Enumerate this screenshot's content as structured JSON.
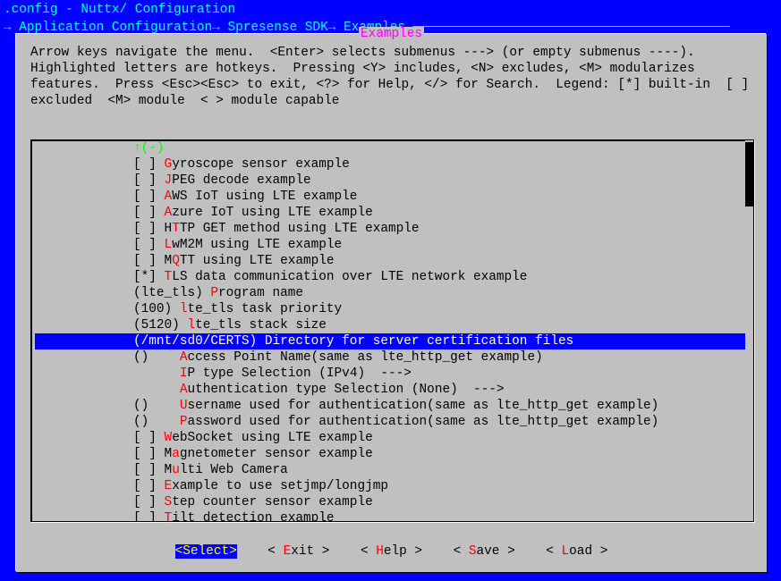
{
  "title_line": ".config - Nuttx/ Configuration",
  "breadcrumb": "→ Application Configuration→ Spresense SDK→ Examples ─────────────────────────────────────────",
  "dialog_title": "Examples",
  "help_text": "Arrow keys navigate the menu.  <Enter> selects submenus ---> (or empty submenus ----).  Highlighted letters are hotkeys.  Pressing <Y> includes, <N> excludes, <M> modularizes features.  Press <Esc><Esc> to exit, <?> for Help, </> for Search.  Legend: [*] built-in  [ ] excluded  <M> module  < > module capable",
  "scroll_indicator": "↑(-)",
  "menu": [
    {
      "prefix": "[ ] ",
      "hot": "G",
      "rest": "yroscope sensor example"
    },
    {
      "prefix": "[ ] ",
      "hot": "J",
      "rest": "PEG decode example"
    },
    {
      "prefix": "[ ] ",
      "hot": "A",
      "rest": "WS IoT using LTE example"
    },
    {
      "prefix": "[ ] ",
      "hot": "A",
      "rest": "zure IoT using LTE example"
    },
    {
      "prefix": "[ ] H",
      "hot": "T",
      "rest": "TP GET method using LTE example"
    },
    {
      "prefix": "[ ] ",
      "hot": "L",
      "rest": "wM2M using LTE example"
    },
    {
      "prefix": "[ ] M",
      "hot": "Q",
      "rest": "TT using LTE example"
    },
    {
      "prefix": "[*] ",
      "hot": "T",
      "rest": "LS data communication over LTE network example"
    },
    {
      "prefix": "(lte_tls) ",
      "hot": "P",
      "rest": "rogram name"
    },
    {
      "prefix": "(100) ",
      "hot": "l",
      "rest": "te_tls task priority"
    },
    {
      "prefix": "(5120) ",
      "hot": "l",
      "rest": "te_tls stack size"
    },
    {
      "prefix": "(/mnt/sd0/CERTS) ",
      "hot": "D",
      "rest": "irectory for server certification files",
      "selected": true
    },
    {
      "prefix": "()    ",
      "hot": "A",
      "rest": "ccess Point Name(same as lte_http_get example)"
    },
    {
      "prefix": "      ",
      "hot": "I",
      "rest": "P type Selection (IPv4)  --->"
    },
    {
      "prefix": "      ",
      "hot": "A",
      "rest": "uthentication type Selection (None)  --->"
    },
    {
      "prefix": "()    ",
      "hot": "U",
      "rest": "sername used for authentication(same as lte_http_get example)"
    },
    {
      "prefix": "()    ",
      "hot": "P",
      "rest": "assword used for authentication(same as lte_http_get example)"
    },
    {
      "prefix": "[ ] ",
      "hot": "W",
      "rest": "ebSocket using LTE example"
    },
    {
      "prefix": "[ ] M",
      "hot": "a",
      "rest": "gnetometer sensor example"
    },
    {
      "prefix": "[ ] M",
      "hot": "u",
      "rest": "lti Web Camera"
    },
    {
      "prefix": "[ ] ",
      "hot": "E",
      "rest": "xample to use setjmp/longjmp"
    },
    {
      "prefix": "[ ] ",
      "hot": "S",
      "rest": "tep counter sensor example"
    },
    {
      "prefix": "[ ] ",
      "hot": "T",
      "rest": "ilt detection example"
    }
  ],
  "buttons": {
    "select": {
      "open": "<",
      "hot": "S",
      "rest": "elect",
      "close": ">",
      "active": true
    },
    "exit": {
      "open": "< ",
      "hot": "E",
      "rest": "xit ",
      "close": ">"
    },
    "help": {
      "open": "< ",
      "hot": "H",
      "rest": "elp ",
      "close": ">"
    },
    "save": {
      "open": "< ",
      "hot": "S",
      "rest": "ave ",
      "close": ">"
    },
    "load": {
      "open": "< ",
      "hot": "L",
      "rest": "oad ",
      "close": ">"
    }
  },
  "button_gap": "    "
}
